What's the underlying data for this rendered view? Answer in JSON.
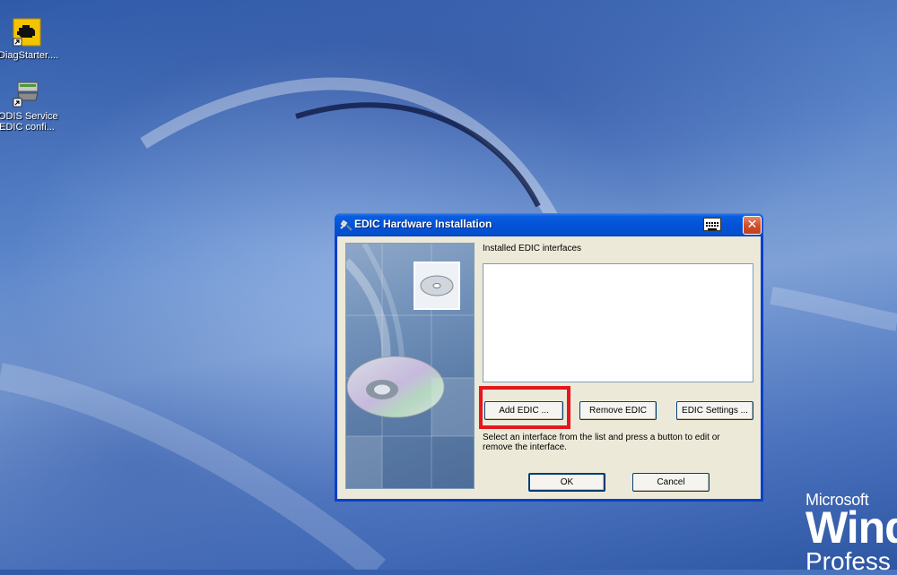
{
  "desktop": {
    "icons": [
      {
        "label": "DiagStarter...."
      },
      {
        "label_line1": "ODIS Service",
        "label_line2": "EDIC confi..."
      }
    ]
  },
  "os_logo": {
    "brand": "Microsoft",
    "name": "Wind",
    "edition": "Profess"
  },
  "dialog": {
    "title": "EDIC Hardware Installation",
    "close_glyph": "✕",
    "installed_label": "Installed EDIC interfaces",
    "installed_items": [],
    "buttons": {
      "add": "Add EDIC ...",
      "remove": "Remove EDIC",
      "settings": "EDIC Settings ...",
      "ok": "OK",
      "cancel": "Cancel"
    },
    "hint": "Select an interface from the list and press a button to edit or remove the interface."
  },
  "colors": {
    "titlebar": "#0453d6",
    "dialog_bg": "#ece9d8",
    "highlight": "#e3171d",
    "desktop": "#4a72bd"
  }
}
